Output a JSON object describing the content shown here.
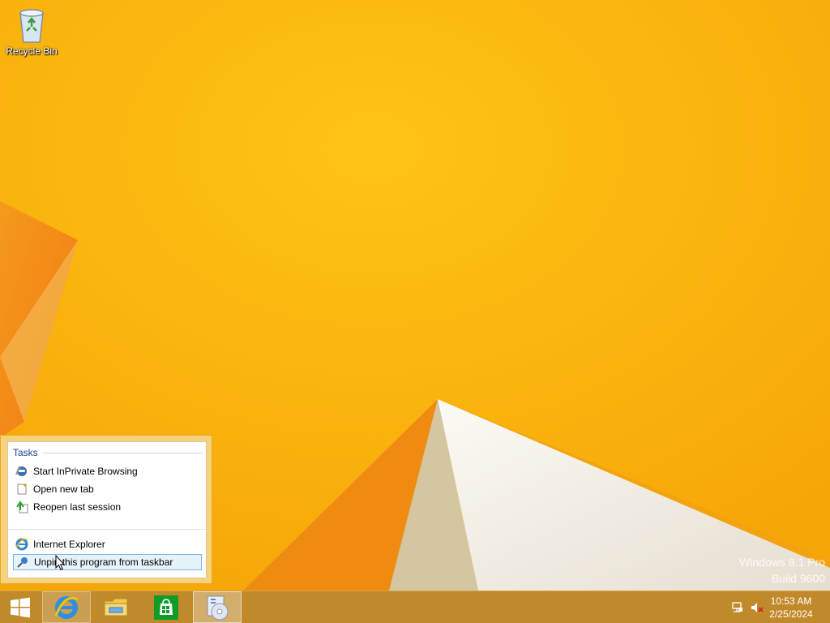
{
  "desktop": {
    "icons": [
      {
        "label": "Recycle Bin",
        "icon": "recycle-bin-icon"
      }
    ],
    "watermark": {
      "line1": "Windows 8.1 Pro",
      "line2": "Build 9600"
    },
    "colors": {
      "wallpaper": "#fbb507",
      "taskbar": "#c08a2b"
    }
  },
  "jumplist": {
    "section_title": "Tasks",
    "tasks": [
      {
        "label": "Start InPrivate Browsing",
        "icon": "inprivate-icon"
      },
      {
        "label": "Open new tab",
        "icon": "new-tab-icon"
      },
      {
        "label": "Reopen last session",
        "icon": "reopen-session-icon"
      }
    ],
    "app_item": {
      "label": "Internet Explorer",
      "icon": "internet-explorer-icon"
    },
    "unpin_item": {
      "label": "Unpin this program from taskbar",
      "icon": "unpin-icon"
    }
  },
  "taskbar": {
    "start": {
      "icon": "windows-logo-icon"
    },
    "apps": [
      {
        "name": "Internet Explorer",
        "icon": "internet-explorer-icon",
        "state": "active"
      },
      {
        "name": "File Explorer",
        "icon": "file-explorer-icon",
        "state": "normal"
      },
      {
        "name": "Store",
        "icon": "store-icon",
        "state": "normal"
      },
      {
        "name": "Installer",
        "icon": "installer-disc-icon",
        "state": "pressed"
      }
    ],
    "tray": {
      "network_icon": "network-icon",
      "volume_icon": "volume-muted-icon",
      "time": "10:53 AM",
      "date": "2/25/2024"
    }
  }
}
